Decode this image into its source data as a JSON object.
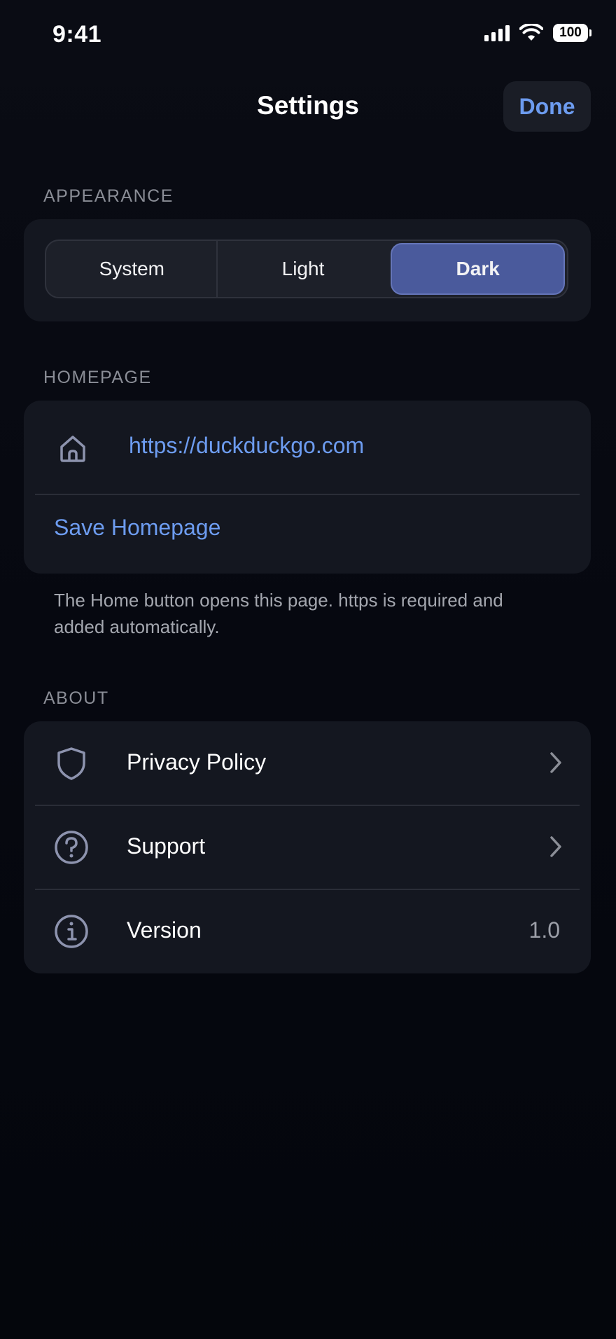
{
  "status_bar": {
    "time": "9:41",
    "battery": "100"
  },
  "nav": {
    "title": "Settings",
    "done_label": "Done"
  },
  "appearance": {
    "header": "APPEARANCE",
    "options": [
      "System",
      "Light",
      "Dark"
    ],
    "selected": "Dark"
  },
  "homepage": {
    "header": "HOMEPAGE",
    "url": "https://duckduckgo.com",
    "save_label": "Save Homepage",
    "footnote": "The Home button opens this page. https is required and added automatically."
  },
  "about": {
    "header": "ABOUT",
    "items": [
      {
        "label": "Privacy Policy",
        "icon": "shield-icon",
        "accessory": "chevron"
      },
      {
        "label": "Support",
        "icon": "question-circle-icon",
        "accessory": "chevron"
      },
      {
        "label": "Version",
        "icon": "info-circle-icon",
        "value": "1.0"
      }
    ]
  },
  "colors": {
    "accent": "#6d9cf0",
    "selected_segment": "#4a5a9c",
    "background": "#06070d",
    "card": "#141720"
  }
}
